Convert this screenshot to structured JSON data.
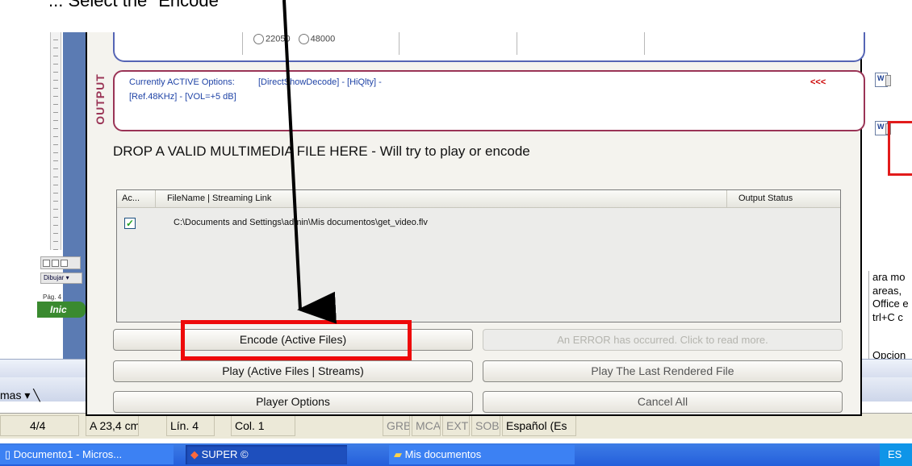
{
  "top_caption": "... Select the \"Encode\"",
  "word": {
    "left": {
      "draw_label": "Dibujar",
      "page_label": "Pág. 4",
      "start_label": "Inic"
    },
    "right": {
      "task_lines": [
        "ara mo",
        "areas,",
        "Office e",
        "trl+C c"
      ],
      "options_label": "Opcion"
    },
    "toolbar": {
      "formas_label": "mas ▾"
    },
    "status": {
      "page": "4/4",
      "at": "A 23,4 cm",
      "line": "Lín. 4",
      "col": "Col. 1",
      "grb": "GRB",
      "mca": "MCA",
      "ext": "EXT",
      "sob": "SOB",
      "lang": "Español (Es"
    }
  },
  "taskbar": {
    "items": [
      "Documento1 - Micros...",
      "SUPER ©",
      "Mis documentos"
    ],
    "tray": "ES"
  },
  "app": {
    "input_radios": [
      "22050",
      "48000"
    ],
    "output_label": "OUTPUT",
    "output_line1_label": "Currently ACTIVE Options:",
    "output_line1_value": "[DirectShowDecode] - [HiQlty] -",
    "output_line2": "[Ref.48KHz] - [VOL=+5 dB]",
    "output_arrows": "<<<",
    "drop_text": "DROP A VALID MULTIMEDIA FILE HERE - Will try to play or encode",
    "list": {
      "headers": [
        "Ac...",
        "FileName  |  Streaming Link",
        "Output Status"
      ],
      "rows": [
        {
          "checked": true,
          "check_mark": "✓",
          "file": "C:\\Documents and Settings\\admin\\Mis documentos\\get_video.flv",
          "status": ""
        }
      ]
    },
    "buttons": {
      "encode": "Encode (Active Files)",
      "error": "An ERROR has occurred. Click to read more.",
      "play": "Play (Active Files | Streams)",
      "play_last": "Play The Last Rendered File",
      "options": "Player Options",
      "cancel": "Cancel All"
    }
  },
  "colors": {
    "annotation_red": "#ee0a0a",
    "output_border": "#9a3456",
    "input_border": "#5565b5",
    "text_blue": "#1f43a6"
  }
}
